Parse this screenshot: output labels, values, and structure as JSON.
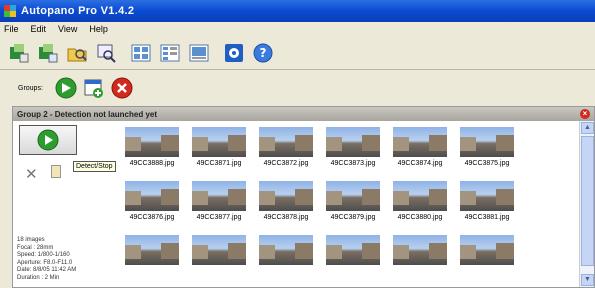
{
  "window": {
    "title": "Autopano Pro V1.4.2"
  },
  "menu": {
    "items": [
      "File",
      "Edit",
      "View",
      "Help"
    ]
  },
  "toolbar": {
    "buttons": [
      "open-project-icon",
      "new-project-icon",
      "open-images-icon",
      "detect-icon",
      "view-list-icon",
      "view-details-icon",
      "view-icons-icon",
      "settings-icon",
      "help-icon"
    ]
  },
  "groups": {
    "label": "Groups:"
  },
  "group": {
    "title": "Group 2 - Detection not launched yet",
    "tooltip": "Detect/Stop",
    "info": {
      "images": "18 images",
      "focal": "Focal : 28mm",
      "speed": "Speed: 1/800-1/160",
      "aperture": "Aperture: F8.0-F11.0",
      "date": "Date: 8/8/05 11:42 AM",
      "duration": "Duration : 2 Min"
    },
    "thumbnails": [
      {
        "name": "49CC3888.jpg"
      },
      {
        "name": "49CC3871.jpg"
      },
      {
        "name": "49CC3872.jpg"
      },
      {
        "name": "49CC3873.jpg"
      },
      {
        "name": "49CC3874.jpg"
      },
      {
        "name": "49CC3875.jpg"
      },
      {
        "name": "49CC3876.jpg"
      },
      {
        "name": "49CC3877.jpg"
      },
      {
        "name": "49CC3878.jpg"
      },
      {
        "name": "49CC3879.jpg"
      },
      {
        "name": "49CC3880.jpg"
      },
      {
        "name": "49CC3881.jpg"
      },
      {
        "name": ""
      },
      {
        "name": ""
      },
      {
        "name": ""
      },
      {
        "name": ""
      },
      {
        "name": ""
      },
      {
        "name": ""
      }
    ]
  },
  "colors": {
    "titlebar": "#0a4bd1",
    "accent_green": "#2e9c2e",
    "close_red": "#d12a1e"
  }
}
